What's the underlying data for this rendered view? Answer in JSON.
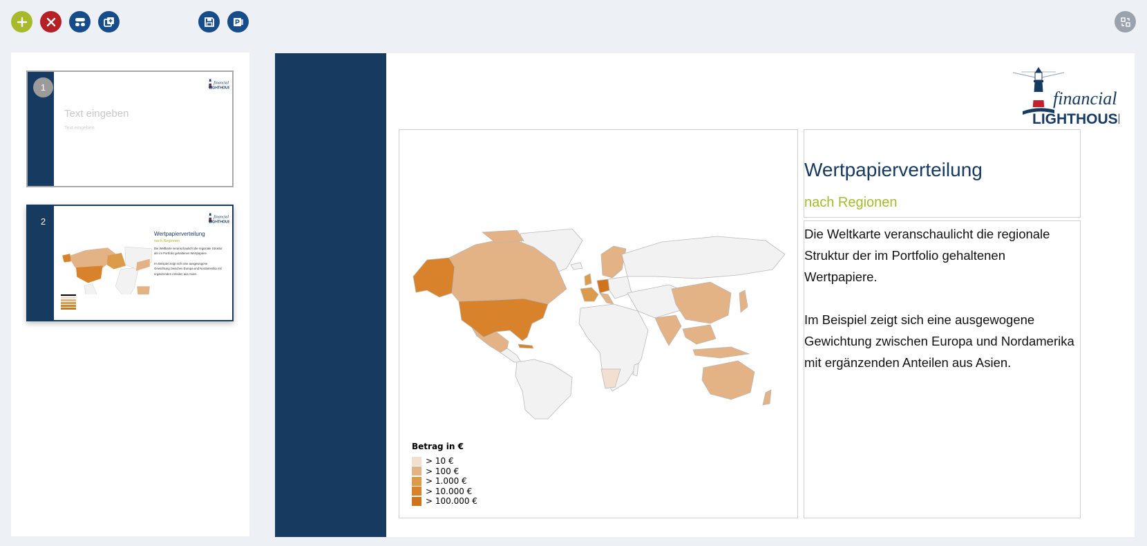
{
  "toolbar": {
    "buttons": [
      {
        "name": "add-slide-button",
        "icon": "plus-icon",
        "color": "#a7ba2c"
      },
      {
        "name": "delete-slide-button",
        "icon": "close-icon",
        "color": "#b52026"
      },
      {
        "name": "layout-button",
        "icon": "layout-icon",
        "color": "#164c8a"
      },
      {
        "name": "duplicate-slide-button",
        "icon": "duplicate-icon",
        "color": "#164c8a"
      },
      {
        "name": "save-button",
        "icon": "floppy-icon",
        "color": "#164c8a"
      },
      {
        "name": "export-powerpoint-button",
        "icon": "powerpoint-icon",
        "color": "#164c8a"
      },
      {
        "name": "swap-view-button",
        "icon": "swap-icon",
        "color": "#9aa3ab"
      }
    ]
  },
  "thumbnails": [
    {
      "number": "1",
      "title": "Text eingeben",
      "subtitle": "Text eingeben",
      "selected": false
    },
    {
      "number": "2",
      "title": "Wertpapierverteilung",
      "subtitle": "nach Regionen",
      "body": [
        "Die Weltkarte veranschaulicht die regionale Struktur der im Portfolio gehaltenen Wertpapiere.",
        "Im Beispiel zeigt sich eine ausgewogene Gewichtung zwischen Europa und Nordamerika mit ergänzenden Anteilen aus Asien."
      ],
      "selected": true
    }
  ],
  "slide": {
    "logo": {
      "word1": "financial",
      "word2": "LIGHTHOUSE",
      "icon": "lighthouse-icon"
    },
    "title": "Wertpapierverteilung",
    "subtitle": "nach Regionen",
    "paragraphs": [
      [
        "Die Weltkarte veranschaulicht die regionale",
        "Struktur der im Portfolio gehaltenen",
        "Wertpapiere."
      ],
      [
        "Im Beispiel zeigt sich eine ausgewogene",
        "Gewichtung zwischen Europa und Nordamerika",
        "mit ergänzenden Anteilen aus Asien."
      ]
    ],
    "legend": {
      "title": "Betrag in €",
      "items": [
        {
          "label": "> 10 €",
          "color": "#f2dfcf"
        },
        {
          "label": "> 100 €",
          "color": "#e3b285"
        },
        {
          "label": "> 1.000 €",
          "color": "#dc9a4b"
        },
        {
          "label": "> 10.000 €",
          "color": "#d8822c"
        },
        {
          "label": "> 100.000 €",
          "color": "#d0731c"
        }
      ]
    },
    "map_colors": {
      "base": "#f2f2f2",
      "border": "#b9b9b9",
      "north_america": "#e3b285",
      "usa": "#d8822c",
      "alaska": "#d8822c",
      "europe": "#dc9a4b",
      "germany": "#d0731c",
      "asia": "#e3b285",
      "australia": "#e3b285",
      "southern_africa": "#f2dfcf"
    }
  },
  "colors": {
    "navy": "#173a61",
    "accent_green": "#a7ba2c"
  }
}
